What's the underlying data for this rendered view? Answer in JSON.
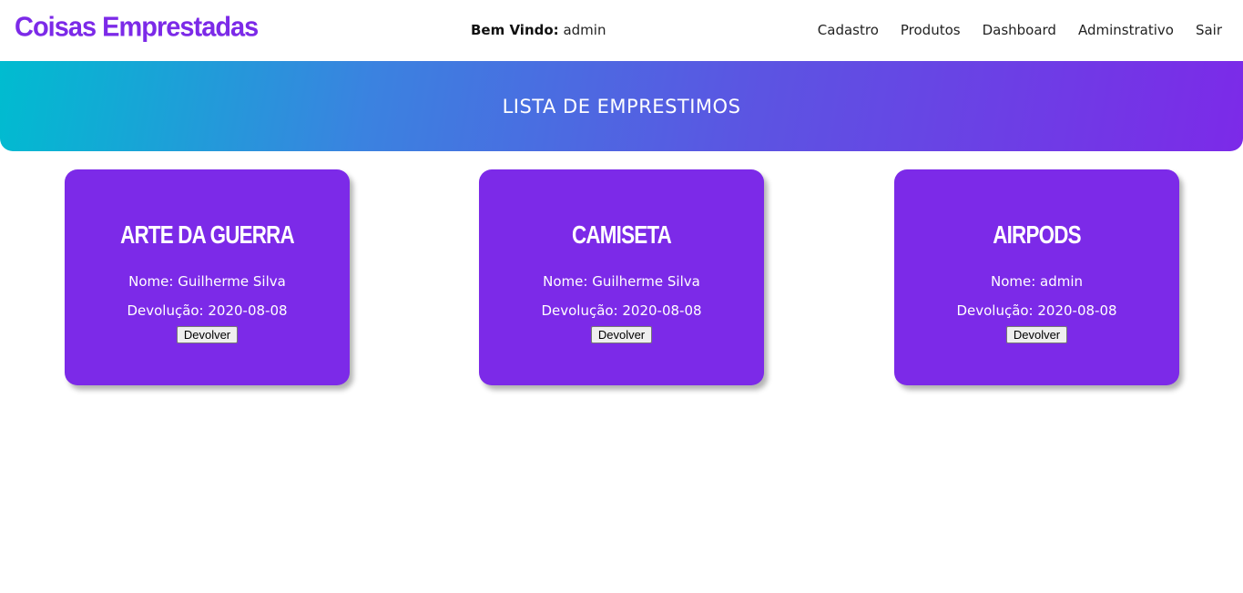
{
  "header": {
    "brand": "Coisas Emprestadas",
    "welcome_label": "Bem Vindo:",
    "welcome_user": "admin",
    "nav": [
      {
        "label": "Cadastro"
      },
      {
        "label": "Produtos"
      },
      {
        "label": "Dashboard"
      },
      {
        "label": "Adminstrativo"
      },
      {
        "label": "Sair"
      }
    ]
  },
  "hero": {
    "title": "LISTA DE EMPRESTIMOS"
  },
  "loans": [
    {
      "item": "ARTE DA GUERRA",
      "name": "Nome: Guilherme Silva",
      "due": "Devolução: 2020-08-08",
      "button": "Devolver"
    },
    {
      "item": "CAMISETA",
      "name": "Nome: Guilherme Silva",
      "due": "Devolução: 2020-08-08",
      "button": "Devolver"
    },
    {
      "item": "AIRPODS",
      "name": "Nome: admin",
      "due": "Devolução: 2020-08-08",
      "button": "Devolver"
    }
  ],
  "colors": {
    "accent": "#7c2ae8",
    "gradient_start": "#00bcd0",
    "gradient_end": "#7c2ae8"
  }
}
